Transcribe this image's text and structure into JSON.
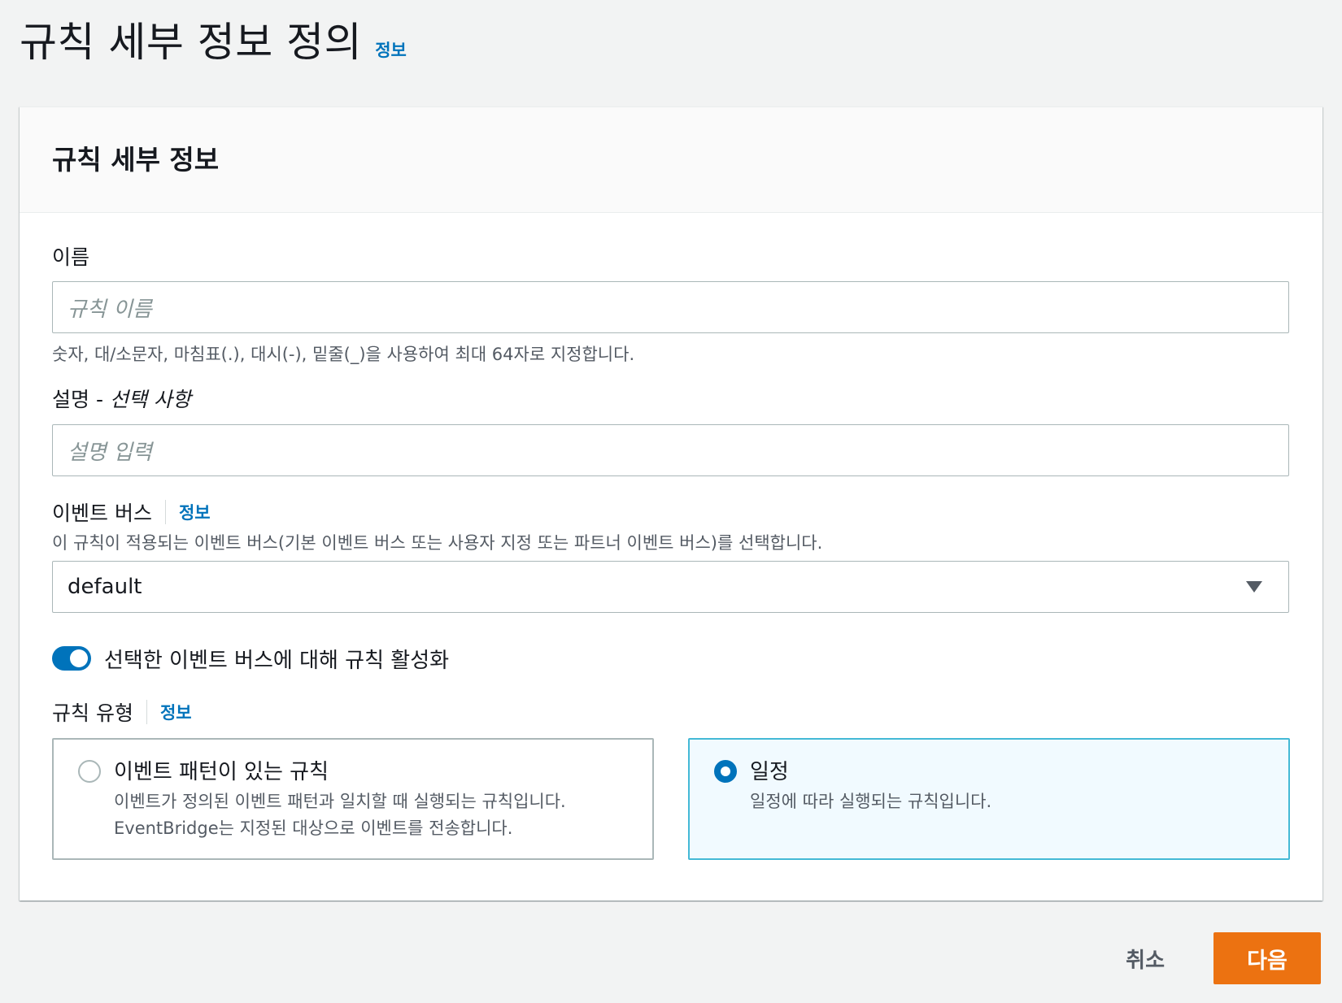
{
  "page": {
    "title": "규칙 세부 정보 정의",
    "info_link": "정보"
  },
  "card": {
    "title": "규칙 세부 정보"
  },
  "name_field": {
    "label": "이름",
    "placeholder": "규칙 이름",
    "constraint": "숫자, 대/소문자, 마침표(.), 대시(-), 밑줄(_)을 사용하여 최대 64자로 지정합니다."
  },
  "description_field": {
    "label": "설명 -",
    "optional": "선택 사항",
    "placeholder": "설명 입력"
  },
  "event_bus": {
    "label": "이벤트 버스",
    "info_link": "정보",
    "description": "이 규칙이 적용되는 이벤트 버스(기본 이벤트 버스 또는 사용자 지정 또는 파트너 이벤트 버스)를 선택합니다.",
    "selected": "default"
  },
  "enable_toggle": {
    "label": "선택한 이벤트 버스에 대해 규칙 활성화",
    "checked": true
  },
  "rule_type": {
    "label": "규칙 유형",
    "info_link": "정보",
    "options": [
      {
        "title": "이벤트 패턴이 있는 규칙",
        "desc_line1": "이벤트가 정의된 이벤트 패턴과 일치할 때 실행되는 규칙입니다.",
        "desc_line2": "EventBridge는 지정된 대상으로 이벤트를 전송합니다.",
        "selected": false
      },
      {
        "title": "일정",
        "desc_line1": "일정에 따라 실행되는 규칙입니다.",
        "selected": true
      }
    ]
  },
  "footer": {
    "cancel_label": "취소",
    "next_label": "다음"
  },
  "colors": {
    "accent": "#0073bb",
    "primary_button": "#ec7211",
    "selected_tile_border": "#44b9d6"
  }
}
